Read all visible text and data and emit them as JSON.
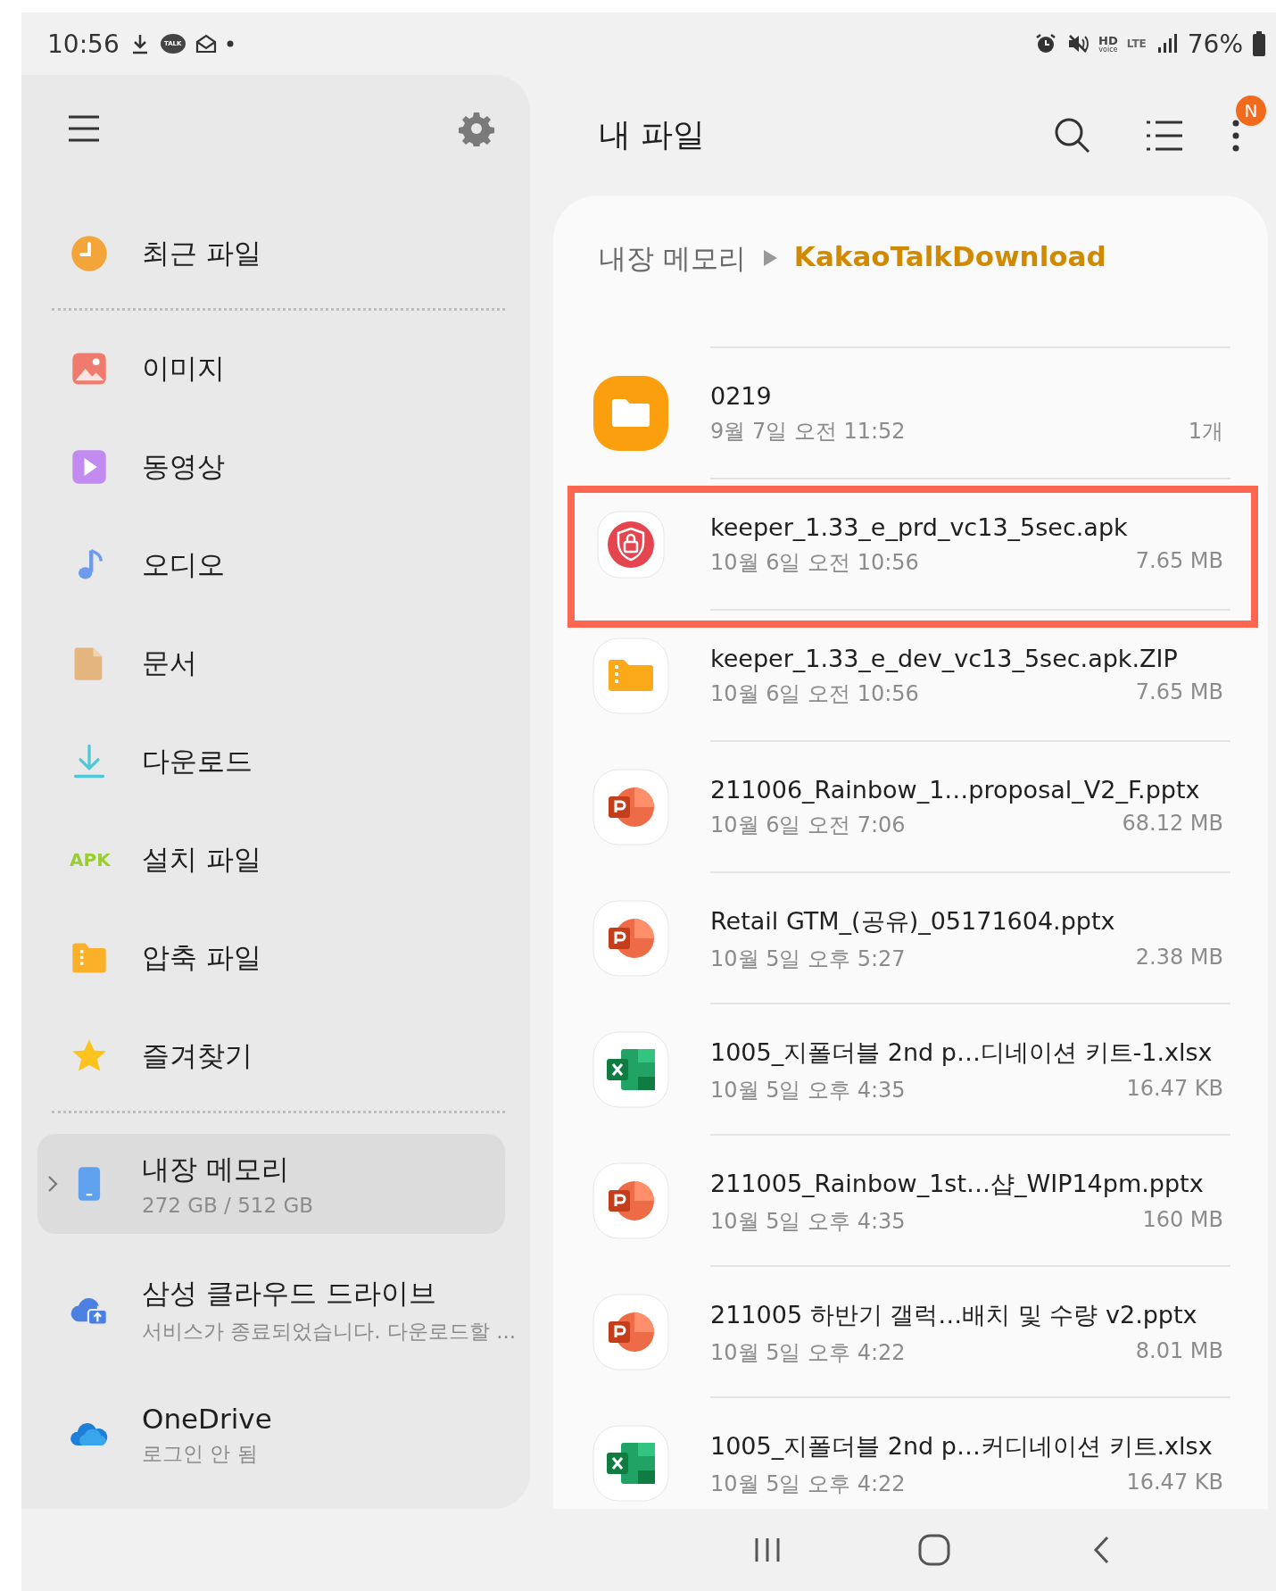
{
  "status_bar": {
    "time": "10:56",
    "chat_icon_label": "TALK",
    "hd_voice": [
      "HD",
      "voice"
    ],
    "network": "LTE",
    "battery": "76%"
  },
  "sidebar": {
    "recent": [
      {
        "label": "최근 파일",
        "kind": "clock",
        "selected": false
      }
    ],
    "categories": [
      {
        "label": "이미지",
        "kind": "image",
        "selected": false
      },
      {
        "label": "동영상",
        "kind": "video",
        "selected": false
      },
      {
        "label": "오디오",
        "kind": "audio",
        "selected": false
      },
      {
        "label": "문서",
        "kind": "document",
        "selected": false
      },
      {
        "label": "다운로드",
        "kind": "download",
        "selected": false
      },
      {
        "label": "설치 파일",
        "kind": "apk",
        "icon_label": "APK",
        "selected": false
      },
      {
        "label": "압축 파일",
        "kind": "zip",
        "selected": false
      },
      {
        "label": "즐겨찾기",
        "kind": "star",
        "selected": false
      }
    ],
    "storage": [
      {
        "title": "내장 메모리",
        "subtitle": "272 GB / 512 GB",
        "kind": "phone",
        "selected": true,
        "expandable": true
      },
      {
        "title": "삼성 클라우드 드라이브",
        "subtitle": "서비스가 종료되었습니다. 다운로드할 ...",
        "kind": "cloud-upload",
        "selected": false,
        "expandable": false
      },
      {
        "title": "OneDrive",
        "subtitle": "로그인 안 됨",
        "kind": "cloud",
        "selected": false,
        "expandable": false
      }
    ]
  },
  "header": {
    "title": "내 파일",
    "notification_badge": "N"
  },
  "breadcrumb": [
    {
      "label": "내장 메모리",
      "current": false
    },
    {
      "label": "KakaoTalkDownload",
      "current": true
    }
  ],
  "files": [
    {
      "kind": "folder",
      "name": "0219",
      "date": "9월 7일 오전 11:52",
      "size": "1개",
      "highlighted": false
    },
    {
      "kind": "apk",
      "name": "keeper_1.33_e_prd_vc13_5sec.apk",
      "date": "10월 6일 오전 10:56",
      "size": "7.65 MB",
      "highlighted": true
    },
    {
      "kind": "zip",
      "name": "keeper_1.33_e_dev_vc13_5sec.apk.ZIP",
      "date": "10월 6일 오전 10:56",
      "size": "7.65 MB",
      "highlighted": false
    },
    {
      "kind": "pptx",
      "name": "211006_Rainbow_1…proposal_V2_F.pptx",
      "date": "10월 6일 오전 7:06",
      "size": "68.12 MB",
      "highlighted": false
    },
    {
      "kind": "pptx",
      "name": "Retail GTM_(공유)_05171604.pptx",
      "date": "10월 5일 오후 5:27",
      "size": "2.38 MB",
      "highlighted": false
    },
    {
      "kind": "xlsx",
      "name": "1005_지폴더블 2nd p…디네이션 키트-1.xlsx",
      "date": "10월 5일 오후 4:35",
      "size": "16.47 KB",
      "highlighted": false
    },
    {
      "kind": "pptx",
      "name": "211005_Rainbow_1st…샵_WIP14pm.pptx",
      "date": "10월 5일 오후 4:35",
      "size": "160 MB",
      "highlighted": false
    },
    {
      "kind": "pptx",
      "name": "211005 하반기 갤럭…배치 및 수량 v2.pptx",
      "date": "10월 5일 오후 4:22",
      "size": "8.01 MB",
      "highlighted": false
    },
    {
      "kind": "xlsx",
      "name": "1005_지폴더블 2nd p…커디네이션 키트.xlsx",
      "date": "10월 5일 오후 4:22",
      "size": "16.47 KB",
      "highlighted": false
    }
  ]
}
